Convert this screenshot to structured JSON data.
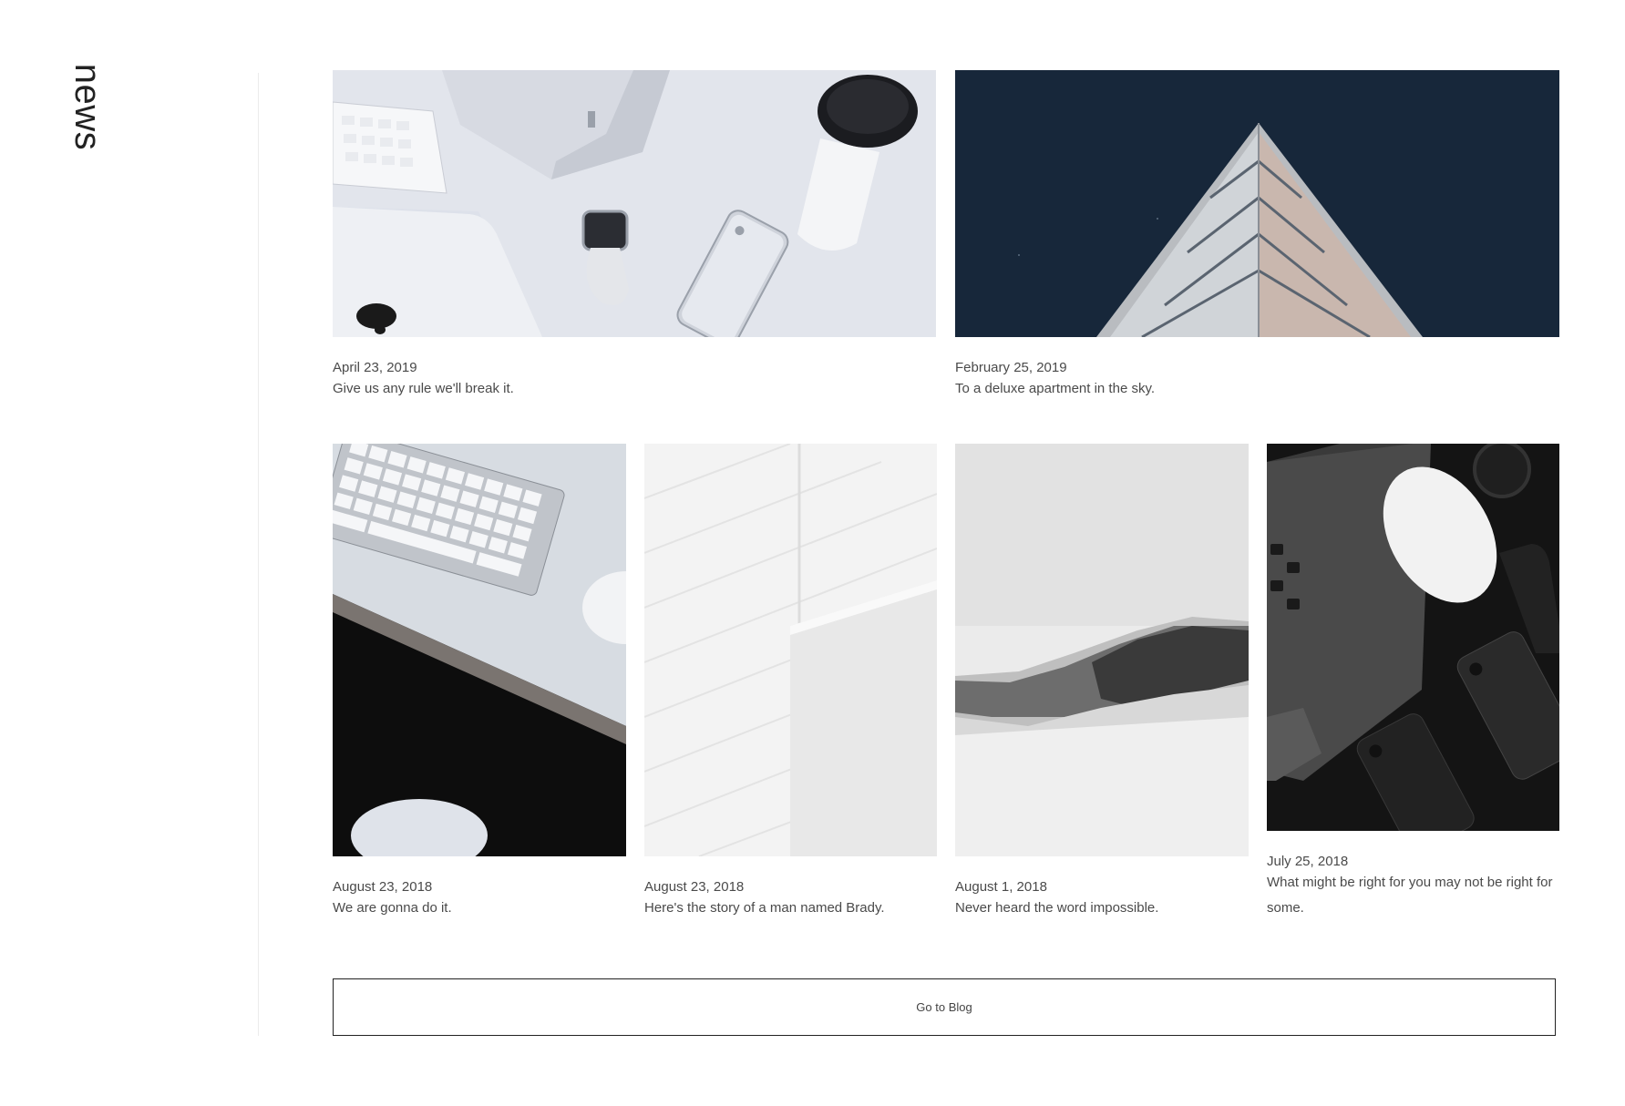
{
  "section": {
    "label": "news"
  },
  "posts": [
    {
      "date": "April 23, 2019",
      "title": "Give us any rule we'll break it.",
      "image": "desk-tech-photo"
    },
    {
      "date": "February 25, 2019",
      "title": "To a deluxe apartment in the sky.",
      "image": "building-corner-photo"
    },
    {
      "date": "August 23, 2018",
      "title": "We are gonna do it.",
      "image": "keyboard-mouse-photo"
    },
    {
      "date": "August 23, 2018",
      "title": "Here's the story of a man named Brady.",
      "image": "white-wall-photo"
    },
    {
      "date": "August 1, 2018",
      "title": "Never heard the word impossible.",
      "image": "snowy-mountain-photo"
    },
    {
      "date": "July 25, 2018",
      "title": "What might be right for you may not be right for some.",
      "image": "dark-devices-photo"
    }
  ],
  "cta": {
    "label": "Go to Blog"
  }
}
